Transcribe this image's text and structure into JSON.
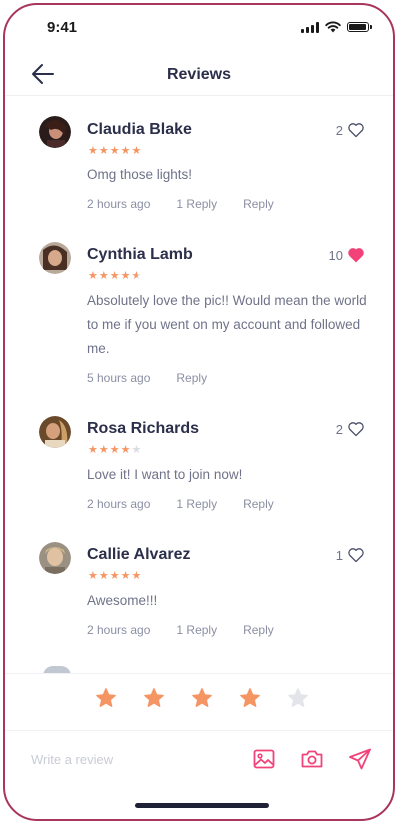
{
  "status_bar": {
    "time": "9:41"
  },
  "header": {
    "title": "Reviews"
  },
  "reviews": [
    {
      "name": "Claudia Blake",
      "rating": 5,
      "text": "Omg those lights!",
      "time": "2 hours ago",
      "replies": "1 Reply",
      "reply_label": "Reply",
      "likes": "2",
      "liked": false
    },
    {
      "name": "Cynthia Lamb",
      "rating": 4.5,
      "text": "Absolutely love the pic!! Would mean the world to me if you went on my account and followed me.",
      "time": "5 hours ago",
      "replies": "",
      "reply_label": "Reply",
      "likes": "10",
      "liked": true
    },
    {
      "name": "Rosa Richards",
      "rating": 4,
      "text": "Love it! I want to join now!",
      "time": "2 hours ago",
      "replies": "1 Reply",
      "reply_label": "Reply",
      "likes": "2",
      "liked": false
    },
    {
      "name": "Callie Alvarez",
      "rating": 5,
      "text": "Awesome!!!",
      "time": "2 hours ago",
      "replies": "1 Reply",
      "reply_label": "Reply",
      "likes": "1",
      "liked": false
    }
  ],
  "rating_input": {
    "value": 4,
    "max": 5
  },
  "composer": {
    "placeholder": "Write a review"
  },
  "colors": {
    "accent": "#f1437a",
    "star": "#f59563",
    "star_empty": "#d9dce3",
    "frame": "#a8355b"
  }
}
